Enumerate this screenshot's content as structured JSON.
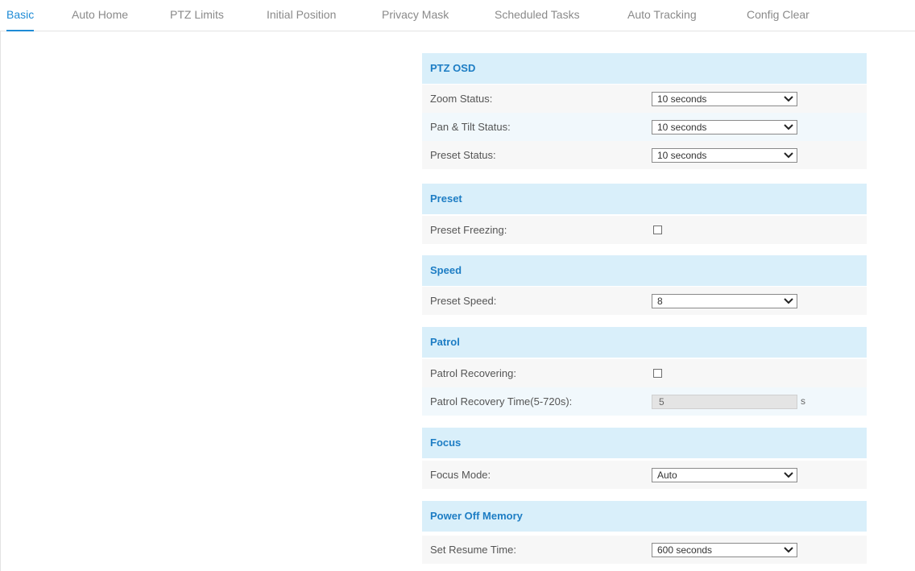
{
  "tabs": [
    {
      "label": "Basic",
      "active": true
    },
    {
      "label": "Auto Home"
    },
    {
      "label": "PTZ Limits"
    },
    {
      "label": "Initial Position"
    },
    {
      "label": "Privacy Mask"
    },
    {
      "label": "Scheduled Tasks"
    },
    {
      "label": "Auto Tracking"
    },
    {
      "label": "Config Clear"
    }
  ],
  "sections": {
    "ptz_osd": {
      "title": "PTZ OSD",
      "zoom_status": {
        "label": "Zoom Status:",
        "value": "10 seconds"
      },
      "pan_tilt_status": {
        "label": "Pan & Tilt Status:",
        "value": "10 seconds"
      },
      "preset_status": {
        "label": "Preset Status:",
        "value": "10 seconds"
      }
    },
    "preset": {
      "title": "Preset",
      "preset_freezing": {
        "label": "Preset Freezing:",
        "checked": false
      }
    },
    "speed": {
      "title": "Speed",
      "preset_speed": {
        "label": "Preset Speed:",
        "value": "8"
      }
    },
    "patrol": {
      "title": "Patrol",
      "patrol_recovering": {
        "label": "Patrol Recovering:",
        "checked": false
      },
      "patrol_recovery_time": {
        "label": "Patrol Recovery Time(5-720s):",
        "value": "5",
        "unit": "s"
      }
    },
    "focus": {
      "title": "Focus",
      "focus_mode": {
        "label": "Focus Mode:",
        "value": "Auto"
      }
    },
    "power_off_memory": {
      "title": "Power Off Memory",
      "set_resume_time": {
        "label": "Set Resume Time:",
        "value": "600 seconds"
      }
    }
  },
  "colors": {
    "accent": "#1e8bd6",
    "section_header_bg": "#d9effa",
    "section_header_text": "#1d7dc4"
  },
  "icons": {
    "dropdown": "chevron-down-icon"
  }
}
